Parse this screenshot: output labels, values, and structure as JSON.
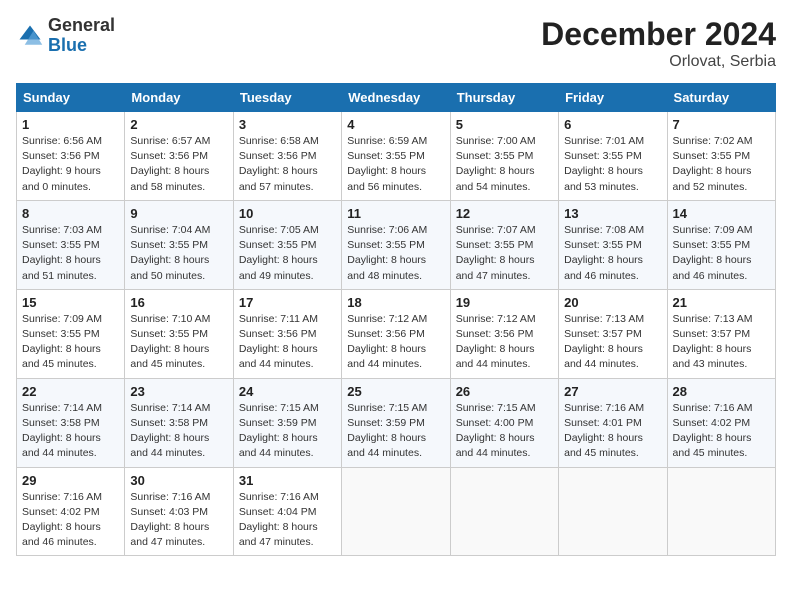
{
  "header": {
    "logo_general": "General",
    "logo_blue": "Blue",
    "title": "December 2024",
    "subtitle": "Orlovat, Serbia"
  },
  "days_of_week": [
    "Sunday",
    "Monday",
    "Tuesday",
    "Wednesday",
    "Thursday",
    "Friday",
    "Saturday"
  ],
  "weeks": [
    [
      {
        "day": "1",
        "info": "Sunrise: 6:56 AM\nSunset: 3:56 PM\nDaylight: 9 hours\nand 0 minutes."
      },
      {
        "day": "2",
        "info": "Sunrise: 6:57 AM\nSunset: 3:56 PM\nDaylight: 8 hours\nand 58 minutes."
      },
      {
        "day": "3",
        "info": "Sunrise: 6:58 AM\nSunset: 3:56 PM\nDaylight: 8 hours\nand 57 minutes."
      },
      {
        "day": "4",
        "info": "Sunrise: 6:59 AM\nSunset: 3:55 PM\nDaylight: 8 hours\nand 56 minutes."
      },
      {
        "day": "5",
        "info": "Sunrise: 7:00 AM\nSunset: 3:55 PM\nDaylight: 8 hours\nand 54 minutes."
      },
      {
        "day": "6",
        "info": "Sunrise: 7:01 AM\nSunset: 3:55 PM\nDaylight: 8 hours\nand 53 minutes."
      },
      {
        "day": "7",
        "info": "Sunrise: 7:02 AM\nSunset: 3:55 PM\nDaylight: 8 hours\nand 52 minutes."
      }
    ],
    [
      {
        "day": "8",
        "info": "Sunrise: 7:03 AM\nSunset: 3:55 PM\nDaylight: 8 hours\nand 51 minutes."
      },
      {
        "day": "9",
        "info": "Sunrise: 7:04 AM\nSunset: 3:55 PM\nDaylight: 8 hours\nand 50 minutes."
      },
      {
        "day": "10",
        "info": "Sunrise: 7:05 AM\nSunset: 3:55 PM\nDaylight: 8 hours\nand 49 minutes."
      },
      {
        "day": "11",
        "info": "Sunrise: 7:06 AM\nSunset: 3:55 PM\nDaylight: 8 hours\nand 48 minutes."
      },
      {
        "day": "12",
        "info": "Sunrise: 7:07 AM\nSunset: 3:55 PM\nDaylight: 8 hours\nand 47 minutes."
      },
      {
        "day": "13",
        "info": "Sunrise: 7:08 AM\nSunset: 3:55 PM\nDaylight: 8 hours\nand 46 minutes."
      },
      {
        "day": "14",
        "info": "Sunrise: 7:09 AM\nSunset: 3:55 PM\nDaylight: 8 hours\nand 46 minutes."
      }
    ],
    [
      {
        "day": "15",
        "info": "Sunrise: 7:09 AM\nSunset: 3:55 PM\nDaylight: 8 hours\nand 45 minutes."
      },
      {
        "day": "16",
        "info": "Sunrise: 7:10 AM\nSunset: 3:55 PM\nDaylight: 8 hours\nand 45 minutes."
      },
      {
        "day": "17",
        "info": "Sunrise: 7:11 AM\nSunset: 3:56 PM\nDaylight: 8 hours\nand 44 minutes."
      },
      {
        "day": "18",
        "info": "Sunrise: 7:12 AM\nSunset: 3:56 PM\nDaylight: 8 hours\nand 44 minutes."
      },
      {
        "day": "19",
        "info": "Sunrise: 7:12 AM\nSunset: 3:56 PM\nDaylight: 8 hours\nand 44 minutes."
      },
      {
        "day": "20",
        "info": "Sunrise: 7:13 AM\nSunset: 3:57 PM\nDaylight: 8 hours\nand 44 minutes."
      },
      {
        "day": "21",
        "info": "Sunrise: 7:13 AM\nSunset: 3:57 PM\nDaylight: 8 hours\nand 43 minutes."
      }
    ],
    [
      {
        "day": "22",
        "info": "Sunrise: 7:14 AM\nSunset: 3:58 PM\nDaylight: 8 hours\nand 44 minutes."
      },
      {
        "day": "23",
        "info": "Sunrise: 7:14 AM\nSunset: 3:58 PM\nDaylight: 8 hours\nand 44 minutes."
      },
      {
        "day": "24",
        "info": "Sunrise: 7:15 AM\nSunset: 3:59 PM\nDaylight: 8 hours\nand 44 minutes."
      },
      {
        "day": "25",
        "info": "Sunrise: 7:15 AM\nSunset: 3:59 PM\nDaylight: 8 hours\nand 44 minutes."
      },
      {
        "day": "26",
        "info": "Sunrise: 7:15 AM\nSunset: 4:00 PM\nDaylight: 8 hours\nand 44 minutes."
      },
      {
        "day": "27",
        "info": "Sunrise: 7:16 AM\nSunset: 4:01 PM\nDaylight: 8 hours\nand 45 minutes."
      },
      {
        "day": "28",
        "info": "Sunrise: 7:16 AM\nSunset: 4:02 PM\nDaylight: 8 hours\nand 45 minutes."
      }
    ],
    [
      {
        "day": "29",
        "info": "Sunrise: 7:16 AM\nSunset: 4:02 PM\nDaylight: 8 hours\nand 46 minutes."
      },
      {
        "day": "30",
        "info": "Sunrise: 7:16 AM\nSunset: 4:03 PM\nDaylight: 8 hours\nand 47 minutes."
      },
      {
        "day": "31",
        "info": "Sunrise: 7:16 AM\nSunset: 4:04 PM\nDaylight: 8 hours\nand 47 minutes."
      },
      null,
      null,
      null,
      null
    ]
  ]
}
